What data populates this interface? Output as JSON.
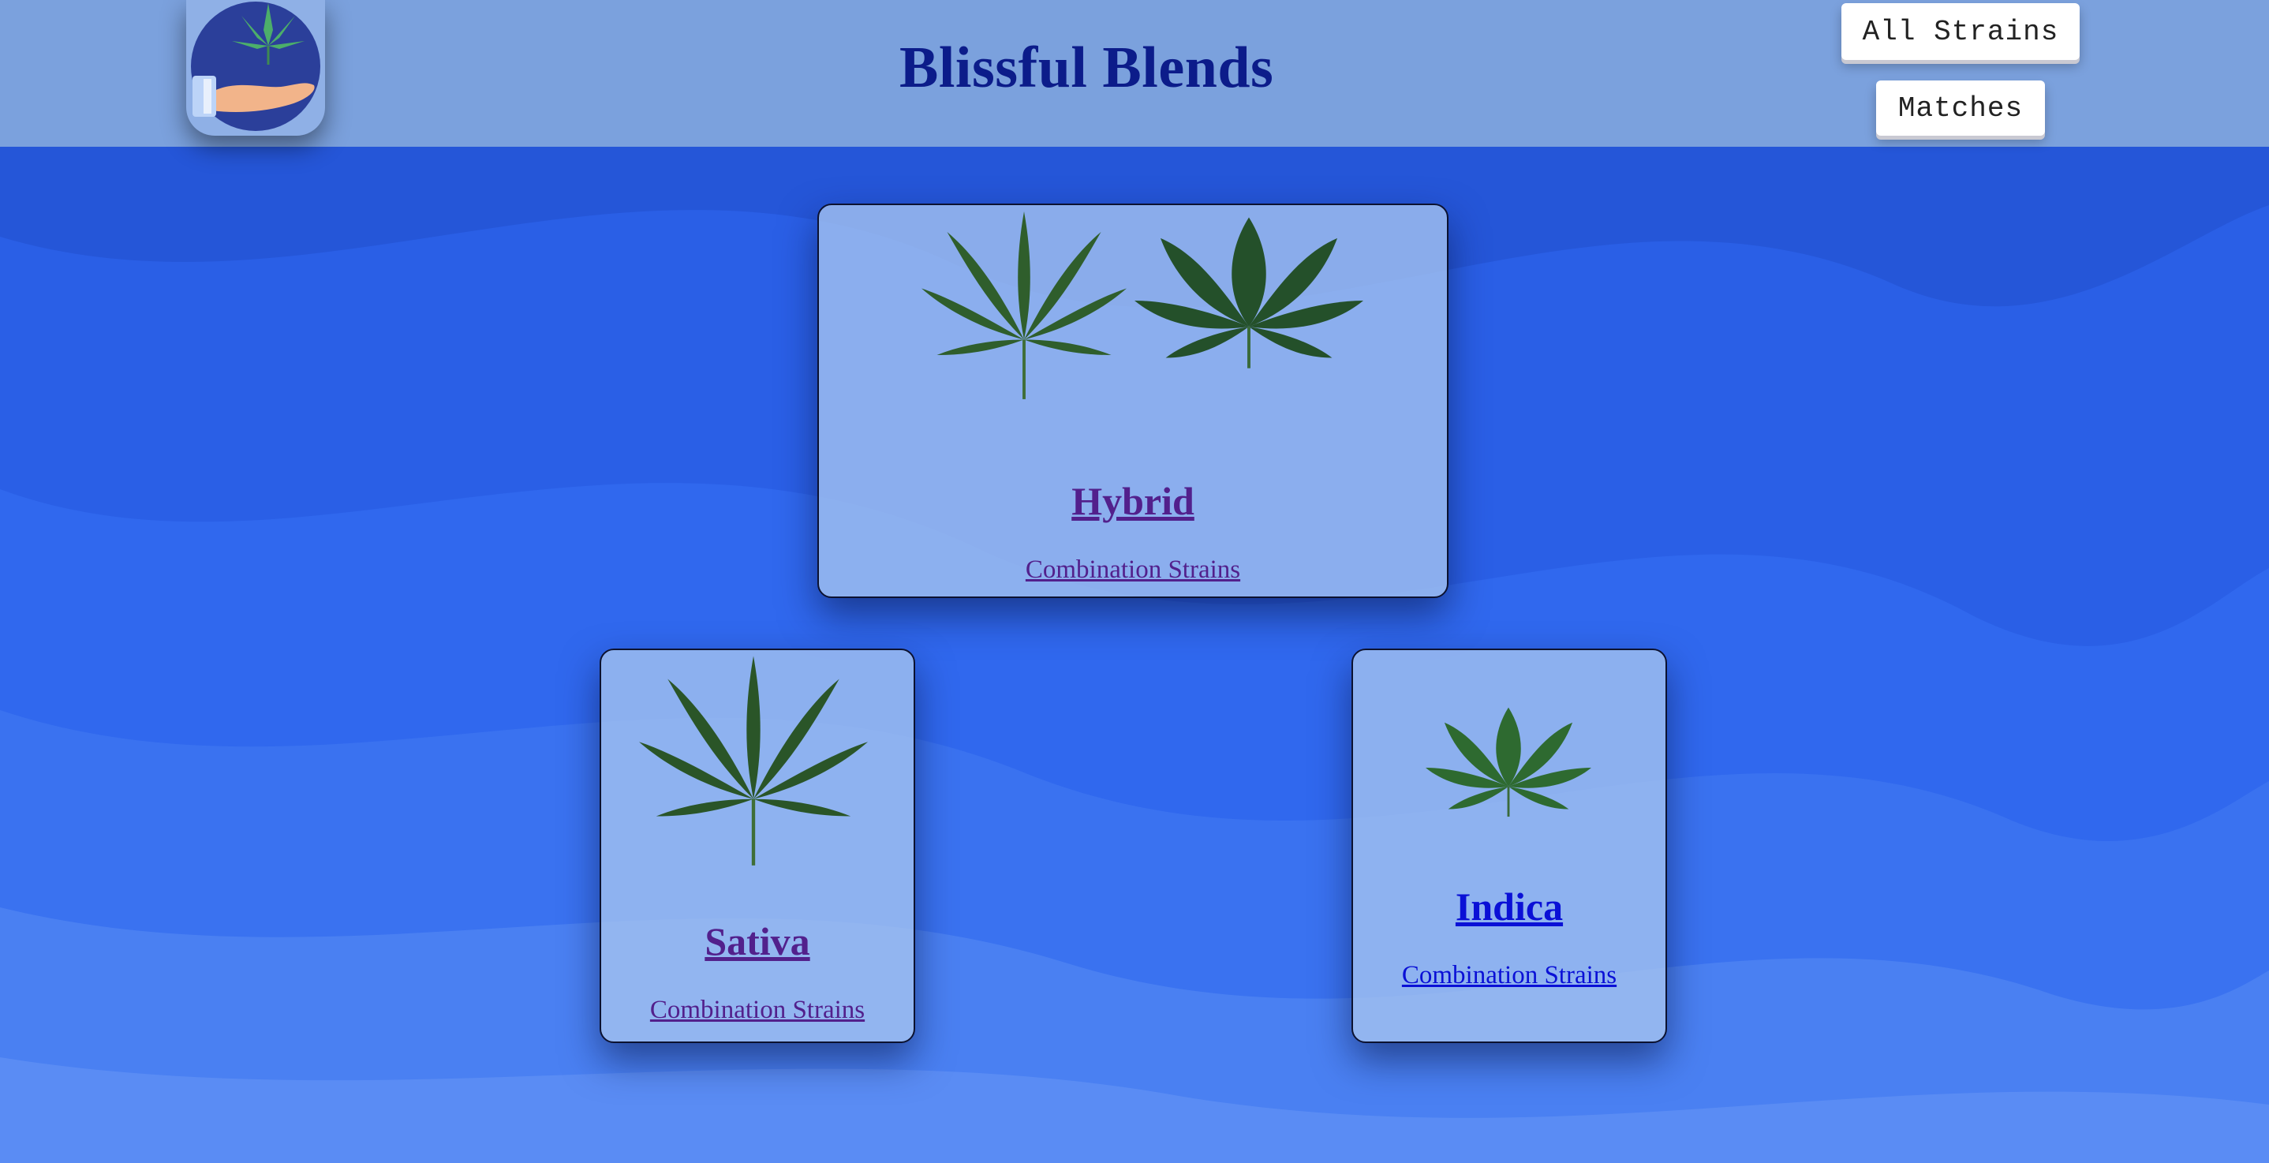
{
  "header": {
    "title": "Blissful Blends",
    "buttons": {
      "all_strains": "All Strains",
      "matches": "Matches"
    }
  },
  "icons": {
    "logo": "hand-holding-leaf-icon",
    "leaf": "cannabis-leaf-icon"
  },
  "cards": {
    "hybrid": {
      "title": "Hybrid",
      "link": "Combination Strains"
    },
    "sativa": {
      "title": "Sativa",
      "link": "Combination Strains"
    },
    "indica": {
      "title": "Indica",
      "link": "Combination Strains"
    }
  },
  "colors": {
    "header_bg": "#7ba1dd",
    "title": "#0c1c8a",
    "background": "#2c63e8",
    "card_bg": "#a6c4f0",
    "link_visited": "#52208c",
    "link_unvisited": "#0a10d6"
  }
}
